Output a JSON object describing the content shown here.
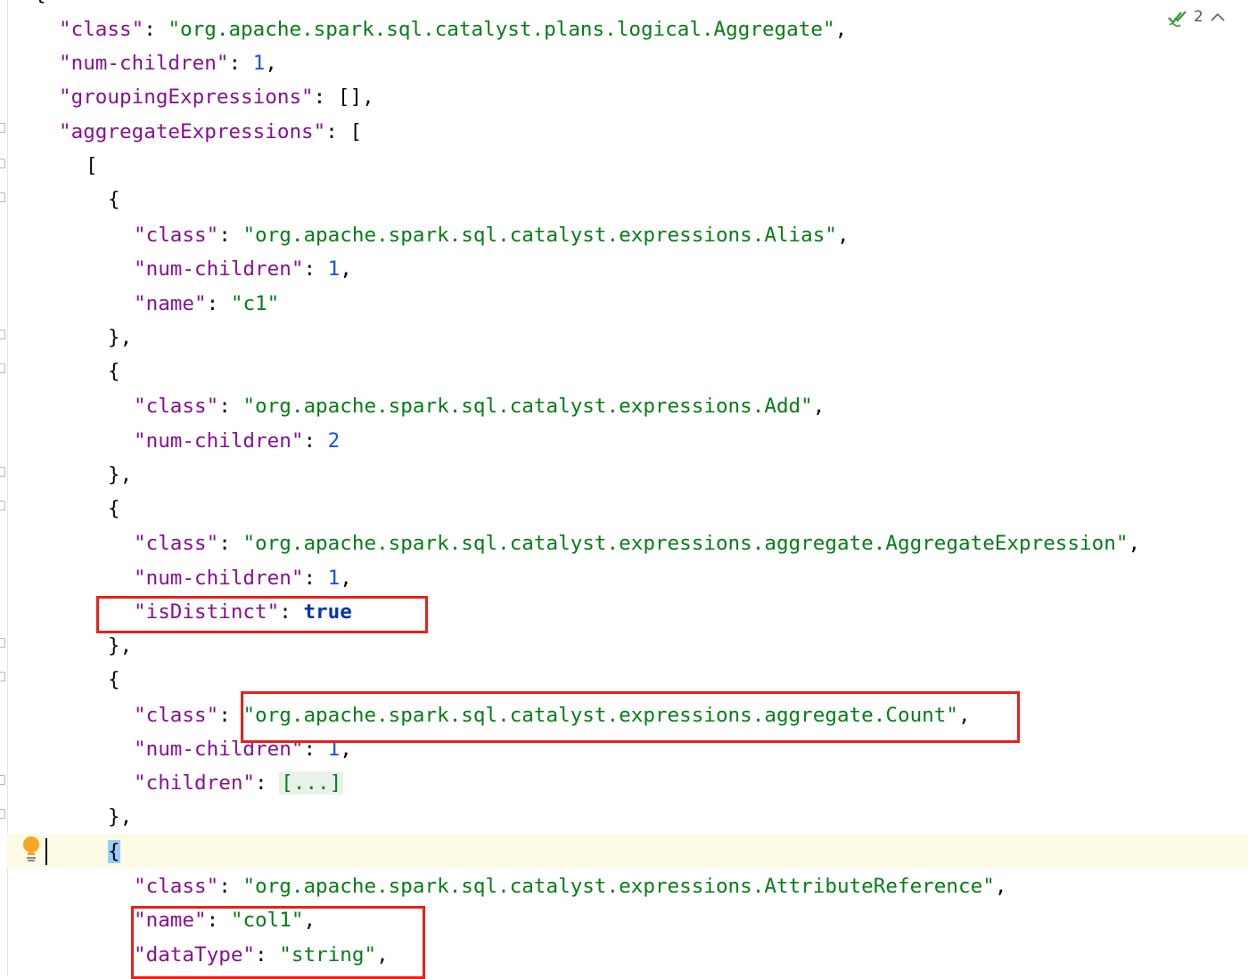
{
  "editor": {
    "inspection_count": "2",
    "icons": {
      "inspection": "double-check-icon",
      "collapse": "chevron-up-icon",
      "intention": "lightbulb-icon"
    },
    "colors": {
      "key": "#871094",
      "string": "#067d17",
      "number": "#1750eb",
      "keyword": "#0033b3",
      "annotation": "#e8201a",
      "caret_line": "#fdfbe6"
    },
    "top_brace": "{",
    "lines": [
      {
        "key": "\"class\"",
        "value": "\"org.apache.spark.sql.catalyst.plans.logical.Aggregate\"",
        "after": ","
      },
      {
        "key": "\"num-children\"",
        "value": "1",
        "after": ","
      },
      {
        "key": "\"groupingExpressions\"",
        "value": "[]",
        "after": ","
      },
      {
        "key": "\"aggregateExpressions\"",
        "value": "["
      },
      {
        "punct": "["
      },
      {
        "punct": "{"
      },
      {
        "key": "\"class\"",
        "value": "\"org.apache.spark.sql.catalyst.expressions.Alias\"",
        "after": ","
      },
      {
        "key": "\"num-children\"",
        "value": "1",
        "after": ","
      },
      {
        "key": "\"name\"",
        "value": "\"c1\""
      },
      {
        "punct": "},"
      },
      {
        "punct": "{"
      },
      {
        "key": "\"class\"",
        "value": "\"org.apache.spark.sql.catalyst.expressions.Add\"",
        "after": ","
      },
      {
        "key": "\"num-children\"",
        "value": "2"
      },
      {
        "punct": "},"
      },
      {
        "punct": "{"
      },
      {
        "key": "\"class\"",
        "value": "\"org.apache.spark.sql.catalyst.expressions.aggregate.AggregateExpression\"",
        "after": ","
      },
      {
        "key": "\"num-children\"",
        "value": "1",
        "after": ","
      },
      {
        "key": "\"isDistinct\"",
        "value": "true"
      },
      {
        "punct": "},"
      },
      {
        "punct": "{"
      },
      {
        "key": "\"class\"",
        "value": "\"org.apache.spark.sql.catalyst.expressions.aggregate.Count\"",
        "after": ","
      },
      {
        "key": "\"num-children\"",
        "value": "1",
        "after": ","
      },
      {
        "key": "\"children\"",
        "value": "[...]"
      },
      {
        "punct": "},"
      },
      {
        "punct": "{"
      },
      {
        "key": "\"class\"",
        "value": "\"org.apache.spark.sql.catalyst.expressions.AttributeReference\"",
        "after": ","
      },
      {
        "key": "\"name\"",
        "value": "\"col1\"",
        "after": ","
      },
      {
        "key": "\"dataType\"",
        "value": "\"string\"",
        "after": ","
      }
    ]
  }
}
